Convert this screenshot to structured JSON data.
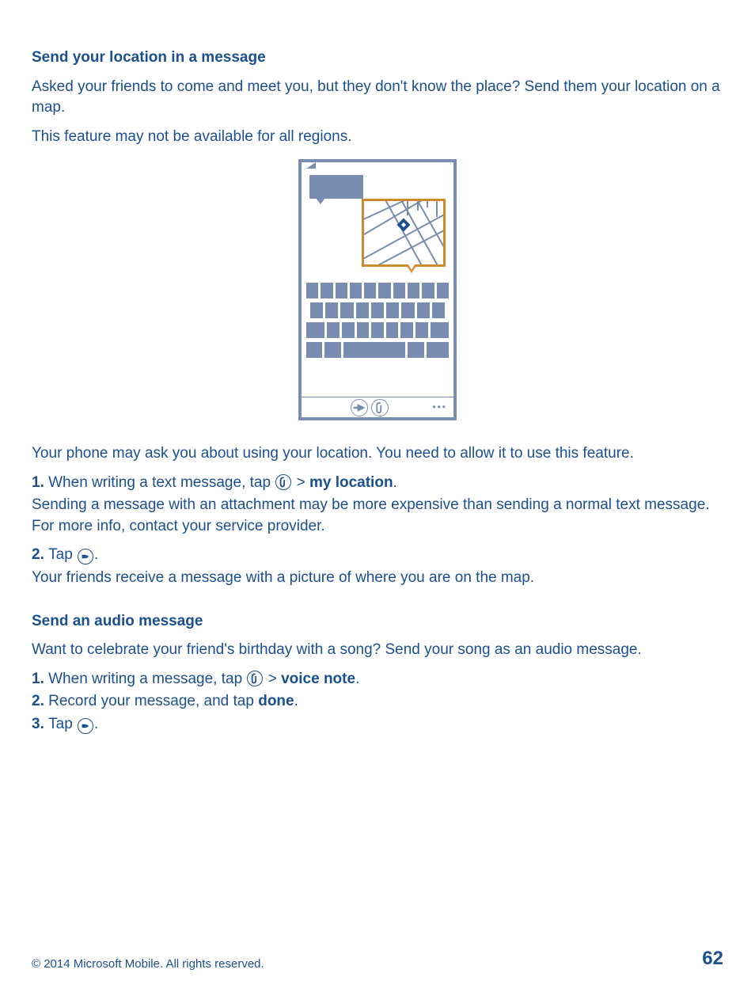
{
  "section1": {
    "heading": "Send your location in a message",
    "p1": "Asked your friends to come and meet you, but they don't know the place? Send them your location on a map.",
    "p2": "This feature may not be available for all regions.",
    "p3": "Your phone may ask you about using your location. You need to allow it to use this feature.",
    "step1_num": "1. ",
    "step1_a": "When writing a text message, tap ",
    "step1_gt": " > ",
    "step1_bold": "my location",
    "step1_end": ".",
    "p4": "Sending a message with an attachment may be more expensive than sending a normal text message. For more info, contact your service provider.",
    "step2_num": "2. ",
    "step2_a": "Tap ",
    "step2_end": ".",
    "p5": "Your friends receive a message with a picture of where you are on the map."
  },
  "section2": {
    "heading": "Send an audio message",
    "p1": "Want to celebrate your friend's birthday with a song? Send your song as an audio message.",
    "step1_num": "1. ",
    "step1_a": "When writing a message, tap ",
    "step1_gt": " > ",
    "step1_bold": "voice note",
    "step1_end": ".",
    "step2_num": "2. ",
    "step2_a": "Record your message, and tap ",
    "step2_bold": "done",
    "step2_end": ".",
    "step3_num": "3. ",
    "step3_a": "Tap ",
    "step3_end": "."
  },
  "footer": {
    "copyright": "© 2014 Microsoft Mobile. All rights reserved.",
    "page": "62"
  },
  "icons": {
    "attach": "attach-icon",
    "send": "send-icon"
  }
}
